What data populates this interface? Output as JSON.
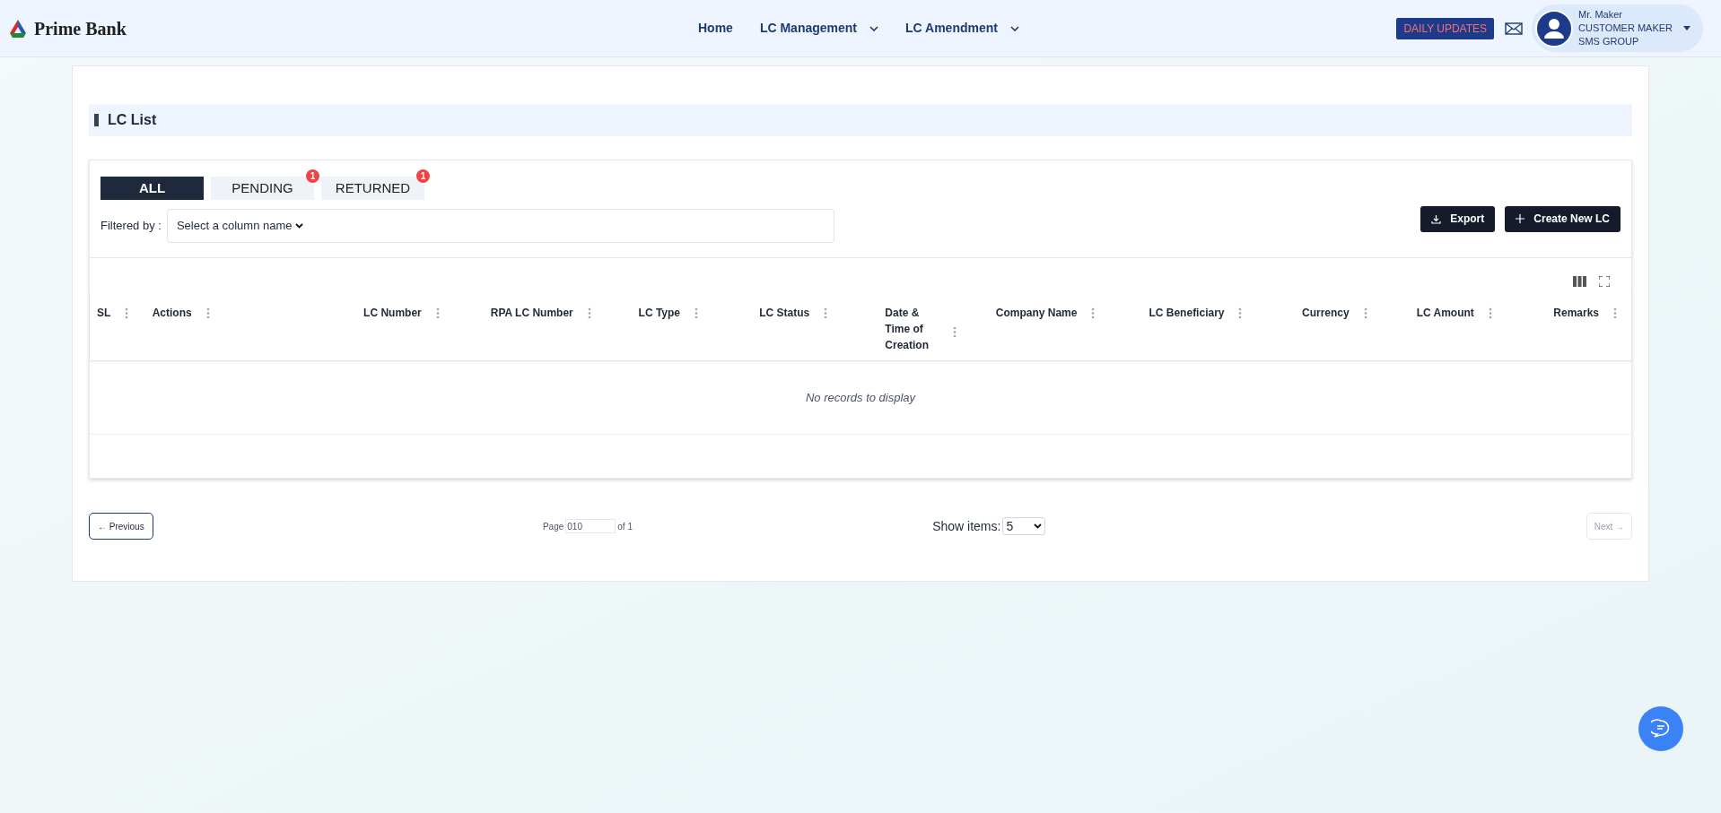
{
  "brand": {
    "name": "Prime Bank"
  },
  "nav": [
    {
      "label": "Home",
      "has_menu": false
    },
    {
      "label": "LC Management",
      "has_menu": true
    },
    {
      "label": "LC Amendment",
      "has_menu": true
    }
  ],
  "daily_updates": "DAILY UPDATES",
  "user": {
    "name": "Mr. Maker",
    "role": "CUSTOMER MAKER",
    "group": "SMS GROUP"
  },
  "page_title": "LC List",
  "tabs": [
    {
      "label": "ALL",
      "selected": true
    },
    {
      "label": "PENDING",
      "selected": false,
      "badge": "1"
    },
    {
      "label": "RETURNED",
      "selected": false,
      "badge": "1"
    }
  ],
  "filter": {
    "label": "Filtered by :",
    "placeholder": "Select a column name"
  },
  "actions": [
    "Export",
    "Create New LC"
  ],
  "table": {
    "columns": [
      "SL",
      "Actions",
      "LC Number",
      "RPA LC Number",
      "LC Type",
      "LC Status",
      "Date & Time of Creation",
      "Company Name",
      "LC Beneficiary",
      "Currency",
      "LC Amount",
      "Remarks"
    ],
    "empty": "No records to display"
  },
  "pagination": {
    "previous": "← Previous",
    "page_label": "Page",
    "page_value": "010",
    "of": "of 1",
    "show_items": "Show items:",
    "items_value": "5",
    "next": "Next →"
  }
}
